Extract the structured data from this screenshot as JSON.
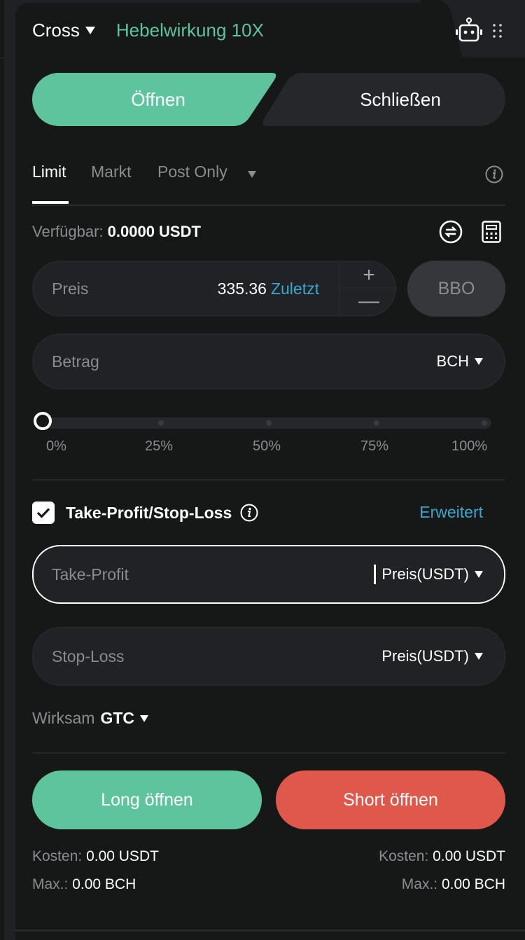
{
  "header": {
    "margin_mode": "Cross",
    "leverage": "Hebelwirkung 10X",
    "icons": [
      "robot-icon",
      "drag-handle-icon"
    ]
  },
  "side_tabs": {
    "open_label": "Öffnen",
    "close_label": "Schließen",
    "active": "open"
  },
  "order_types": {
    "items": [
      "Limit",
      "Markt",
      "Post Only"
    ],
    "active": "Limit"
  },
  "available": {
    "label": "Verfügbar:",
    "value": "0.0000 USDT"
  },
  "price_field": {
    "label": "Preis",
    "value": "335.36",
    "last_label": "Zuletzt",
    "plus": "+",
    "minus": "—"
  },
  "bbo_label": "BBO",
  "amount_field": {
    "placeholder": "Betrag",
    "unit": "BCH"
  },
  "slider": {
    "value_percent": 0,
    "labels": [
      "0%",
      "25%",
      "50%",
      "75%",
      "100%"
    ]
  },
  "tpsl": {
    "checked": true,
    "label": "Take-Profit/Stop-Loss",
    "advanced_label": "Erweitert",
    "take_profit": {
      "placeholder": "Take-Profit",
      "unit": "Preis(USDT)"
    },
    "stop_loss": {
      "placeholder": "Stop-Loss",
      "unit": "Preis(USDT)"
    }
  },
  "time_in_force": {
    "label": "Wirksam",
    "value": "GTC"
  },
  "actions": {
    "long_label": "Long öffnen",
    "short_label": "Short öffnen"
  },
  "summary": {
    "long": {
      "cost_label": "Kosten:",
      "cost_value": "0.00 USDT",
      "max_label": "Max.:",
      "max_value": "0.00 BCH"
    },
    "short": {
      "cost_label": "Kosten:",
      "cost_value": "0.00 USDT",
      "max_label": "Max.:",
      "max_value": "0.00 BCH"
    }
  },
  "colors": {
    "accent_green": "#5ec49e",
    "accent_red": "#e0584b",
    "link_blue": "#3aa8cc",
    "background": "#161818"
  }
}
